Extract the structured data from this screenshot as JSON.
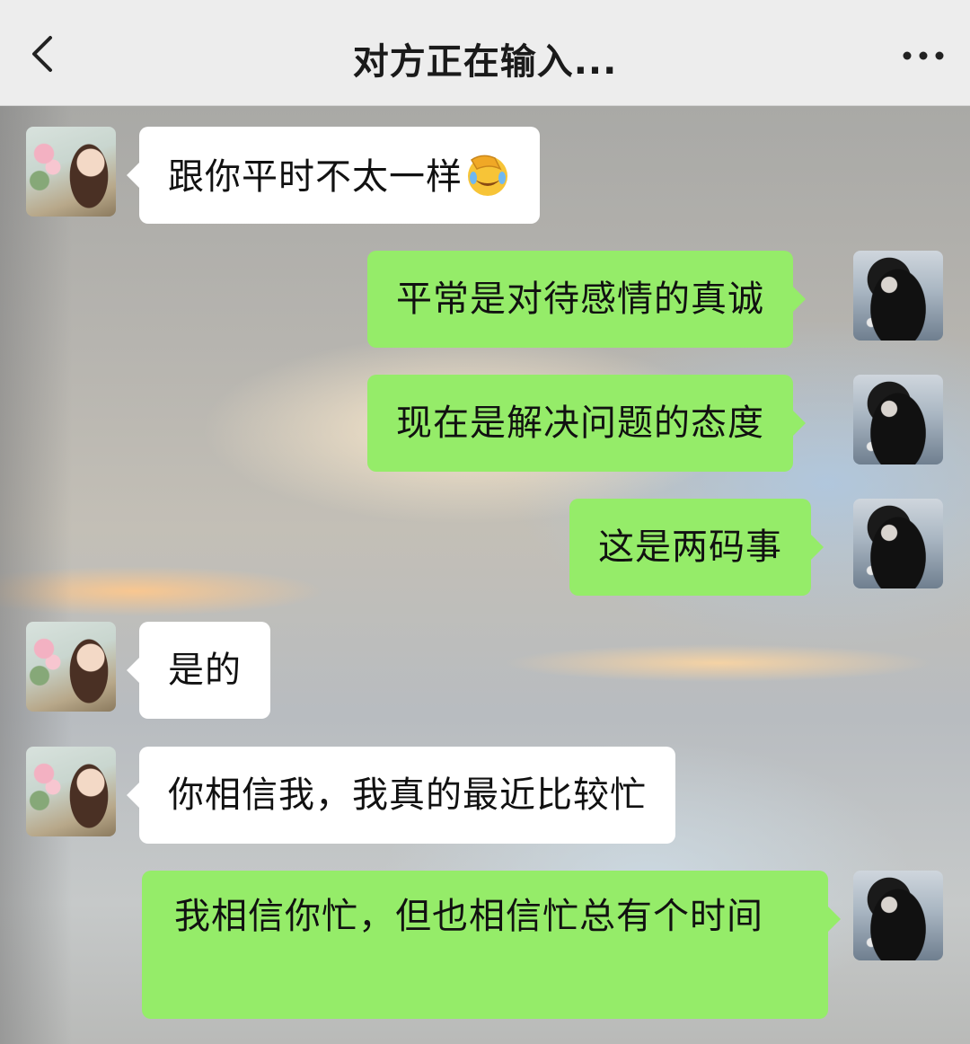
{
  "header": {
    "title": "对方正在输入...",
    "back_icon": "chevron-left-icon",
    "more_icon": "more-dots-icon",
    "background": "#ededed"
  },
  "colors": {
    "sent_bubble": "#95ec69",
    "received_bubble": "#ffffff"
  },
  "messages": [
    {
      "side": "received",
      "text": "跟你平时不太一样",
      "emoji": "face-palm-crying-laughing-emoji"
    },
    {
      "side": "sent",
      "text": "平常是对待感情的真诚"
    },
    {
      "side": "sent",
      "text": "现在是解决问题的态度"
    },
    {
      "side": "sent",
      "text": "这是两码事"
    },
    {
      "side": "received",
      "text": "是的"
    },
    {
      "side": "received",
      "text": "你相信我，我真的最近比较忙"
    },
    {
      "side": "sent",
      "text": "我相信你忙，但也相信忙总有个时间"
    }
  ]
}
